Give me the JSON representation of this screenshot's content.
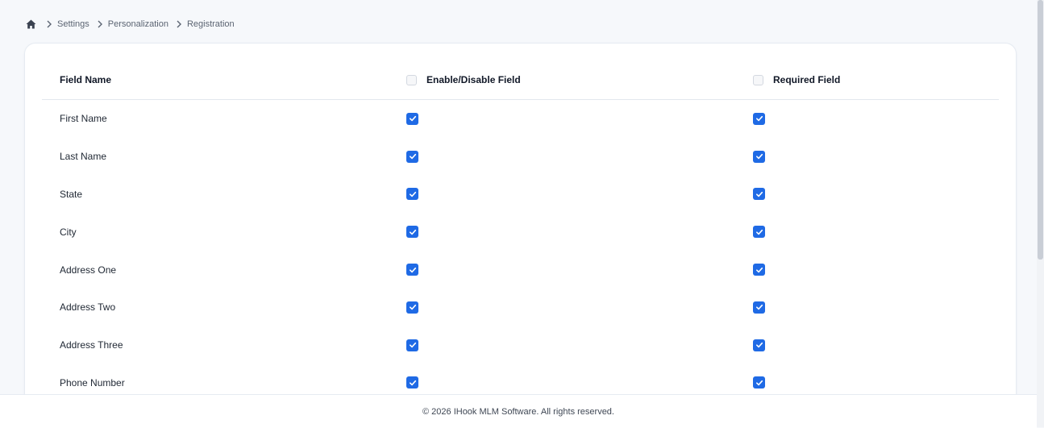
{
  "breadcrumb": {
    "items": [
      "Settings",
      "Personalization",
      "Registration"
    ]
  },
  "table": {
    "headers": {
      "field_name": "Field Name",
      "enable": "Enable/Disable Field",
      "required": "Required Field"
    },
    "rows": [
      {
        "name": "First Name",
        "enabled": true,
        "required": true
      },
      {
        "name": "Last Name",
        "enabled": true,
        "required": true
      },
      {
        "name": "State",
        "enabled": true,
        "required": true
      },
      {
        "name": "City",
        "enabled": true,
        "required": true
      },
      {
        "name": "Address One",
        "enabled": true,
        "required": true
      },
      {
        "name": "Address Two",
        "enabled": true,
        "required": true
      },
      {
        "name": "Address Three",
        "enabled": true,
        "required": true
      },
      {
        "name": "Phone Number",
        "enabled": true,
        "required": true
      }
    ]
  },
  "footer": {
    "text": "© 2026 IHook MLM Software. All rights reserved."
  },
  "colors": {
    "accent": "#1f6ae5",
    "background": "#f6f8fb"
  }
}
